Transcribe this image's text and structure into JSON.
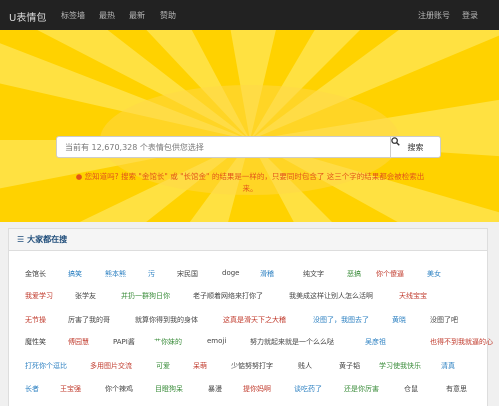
{
  "nav": {
    "brand": "U表情包",
    "links": [
      "标签墙",
      "最热",
      "最新",
      "赞助"
    ],
    "register": "注册账号",
    "login": "登录"
  },
  "search": {
    "placeholder": "当前有 12,670,328 个表情包供您选择",
    "button_label": "搜索",
    "tip_line1": "您知道吗? 搜索 \"金馆长\" 或 \"长馆金\" 的结果是一样的，只要同时包含了 这三个字的结果都会被检索出",
    "tip_line2": "来。"
  },
  "hot": {
    "title": "大家都在搜",
    "rows": [
      [
        {
          "t": "金馆长",
          "c": "#444"
        },
        {
          "t": "搞笑",
          "c": "#2a7fc1"
        },
        {
          "t": "熊本熊",
          "c": "#2a7fc1"
        },
        {
          "t": "污",
          "c": "#2a7fc1"
        },
        {
          "t": "宋民国",
          "c": "#444"
        },
        {
          "t": "doge",
          "c": "#444"
        },
        {
          "t": "滑稽",
          "c": "#2a7fc1"
        },
        {
          "t": "纯文字",
          "c": "#444"
        },
        {
          "t": "恶搞",
          "c": "#3a8c3a"
        },
        {
          "t": "你个傻逼",
          "c": "#c0392b"
        },
        {
          "t": "美女",
          "c": "#2a7fc1"
        }
      ],
      [
        {
          "t": "我爱学习",
          "c": "#c0392b"
        },
        {
          "t": "张学友",
          "c": "#444"
        },
        {
          "t": "并扔一群狗日你",
          "c": "#3a8c3a"
        },
        {
          "t": "老子顺着网络来打你了",
          "c": "#444"
        },
        {
          "t": "我美成这样让别人怎么活啊",
          "c": "#444"
        },
        {
          "t": "天线宝宝",
          "c": "#c0392b"
        }
      ],
      [
        {
          "t": "无节操",
          "c": "#c0392b"
        },
        {
          "t": "厉害了我的哥",
          "c": "#444"
        },
        {
          "t": "就算你得到我的身体",
          "c": "#444"
        },
        {
          "t": "这真是滑天下之大稽",
          "c": "#c0392b"
        },
        {
          "t": "没图了，我图去了",
          "c": "#2a7fc1"
        },
        {
          "t": "黄晓",
          "c": "#2a7fc1"
        },
        {
          "t": "没图了吧",
          "c": "#444"
        }
      ],
      [
        {
          "t": "魔性笑",
          "c": "#444"
        },
        {
          "t": "傅园慧",
          "c": "#c0392b"
        },
        {
          "t": "PAPI酱",
          "c": "#444"
        },
        {
          "t": "艹你妹的",
          "c": "#3a8c3a"
        },
        {
          "t": "emoji",
          "c": "#444"
        },
        {
          "t": "努力就起来就是一个么么哒",
          "c": "#444"
        },
        {
          "t": "吴彦祖",
          "c": "#2a7fc1"
        },
        {
          "t": "也得不到我就逼的心",
          "c": "#c0392b"
        }
      ],
      [
        {
          "t": "打死你个逗比",
          "c": "#2a7fc1"
        },
        {
          "t": "多用图片交流",
          "c": "#c0392b"
        },
        {
          "t": "可爱",
          "c": "#3a8c3a"
        },
        {
          "t": "呆萌",
          "c": "#c0392b"
        },
        {
          "t": "少惦努努打字",
          "c": "#444"
        },
        {
          "t": "贱人",
          "c": "#444"
        },
        {
          "t": "黄子韬",
          "c": "#444"
        },
        {
          "t": "学习使我快乐",
          "c": "#3a8c3a"
        },
        {
          "t": "清真",
          "c": "#2a7fc1"
        }
      ],
      [
        {
          "t": "长者",
          "c": "#2a7fc1"
        },
        {
          "t": "王宝强",
          "c": "#c0392b"
        },
        {
          "t": "你个辣鸡",
          "c": "#444"
        },
        {
          "t": "目瞪狗呆",
          "c": "#3a8c3a"
        },
        {
          "t": "暴漫",
          "c": "#444"
        },
        {
          "t": "提你妈啊",
          "c": "#c0392b"
        },
        {
          "t": "谈吃药了",
          "c": "#2a7fc1"
        },
        {
          "t": "还是你厉害",
          "c": "#3a8c3a"
        },
        {
          "t": "仓鼠",
          "c": "#444"
        },
        {
          "t": "有意思",
          "c": "#444"
        }
      ]
    ]
  }
}
